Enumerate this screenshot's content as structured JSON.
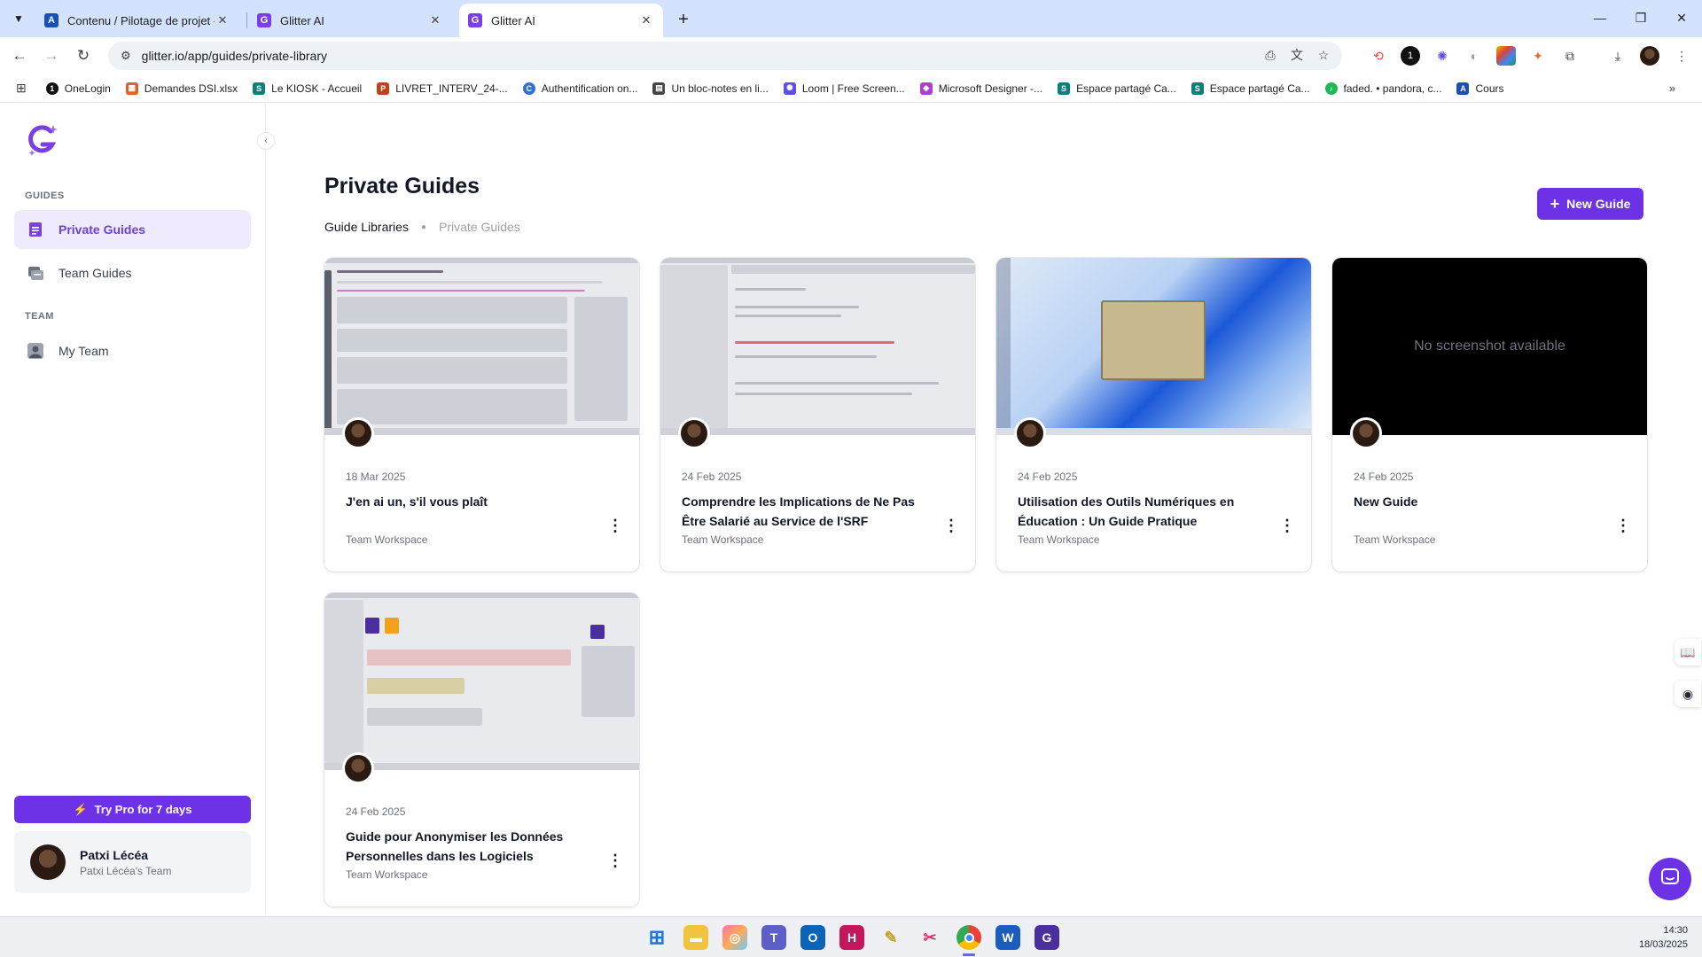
{
  "browser": {
    "tabs": [
      {
        "title": "Contenu / Pilotage de projet - N",
        "favicon": "A",
        "favicon_color": "#1b4fb8"
      },
      {
        "title": "Glitter AI",
        "favicon": "G",
        "favicon_color": "#7b3fe4"
      },
      {
        "title": "Glitter AI",
        "favicon": "G",
        "favicon_color": "#7b3fe4"
      }
    ],
    "url": "glitter.io/app/guides/private-library",
    "bookmarks": [
      {
        "label": "OneLogin",
        "color": "#111111",
        "glyph": "1"
      },
      {
        "label": "Demandes DSI.xlsx",
        "color": "#e0622b",
        "glyph": "▦"
      },
      {
        "label": "Le KIOSK - Accueil",
        "color": "#0b7f7a",
        "glyph": "S"
      },
      {
        "label": "LIVRET_INTERV_24-...",
        "color": "#c43e1c",
        "glyph": "P"
      },
      {
        "label": "Authentification on...",
        "color": "#2f6fd6",
        "glyph": "C"
      },
      {
        "label": "Un bloc-notes en li...",
        "color": "#444444",
        "glyph": "▤"
      },
      {
        "label": "Loom | Free Screen...",
        "color": "#5b4ee8",
        "glyph": "✺"
      },
      {
        "label": "Microsoft Designer -...",
        "color": "#b03cd6",
        "glyph": "◆"
      },
      {
        "label": "Espace partagé Ca...",
        "color": "#0b7f7a",
        "glyph": "S"
      },
      {
        "label": "Espace partagé Ca...",
        "color": "#0b7f7a",
        "glyph": "S"
      },
      {
        "label": "faded. • pandora, c...",
        "color": "#1db954",
        "glyph": "♪"
      },
      {
        "label": "Cours",
        "color": "#1b4fb8",
        "glyph": "A"
      }
    ]
  },
  "sidebar": {
    "section_guides": "GUIDES",
    "section_team": "TEAM",
    "items": [
      {
        "label": "Private Guides"
      },
      {
        "label": "Team Guides"
      },
      {
        "label": "My Team"
      }
    ],
    "pro_button": "Try Pro for 7 days",
    "user": {
      "name": "Patxi Lécéa",
      "team": "Patxi Lécéa's Team"
    }
  },
  "main": {
    "title": "Private Guides",
    "breadcrumb": {
      "root": "Guide Libraries",
      "current": "Private Guides"
    },
    "new_guide_button": "New Guide",
    "no_screenshot": "No screenshot available",
    "guides": [
      {
        "date": "18 Mar 2025",
        "title": "J'en ai un, s'il vous plaît",
        "workspace": "Team Workspace"
      },
      {
        "date": "24 Feb 2025",
        "title": "Comprendre les Implications de Ne Pas Être Salarié au Service de l'SRF",
        "workspace": "Team Workspace"
      },
      {
        "date": "24 Feb 2025",
        "title": "Utilisation des Outils Numériques en Éducation : Un Guide Pratique",
        "workspace": "Team Workspace"
      },
      {
        "date": "24 Feb 2025",
        "title": "New Guide",
        "workspace": "Team Workspace"
      },
      {
        "date": "24 Feb 2025",
        "title": "Guide pour Anonymiser les Données Personnelles dans les Logiciels",
        "workspace": "Team Workspace"
      }
    ]
  },
  "taskbar": {
    "time": "14:30",
    "date": "18/03/2025"
  },
  "colors": {
    "accent": "#6d32e6",
    "accent_light": "#efeafd",
    "titlebar": "#d3e3fd"
  }
}
